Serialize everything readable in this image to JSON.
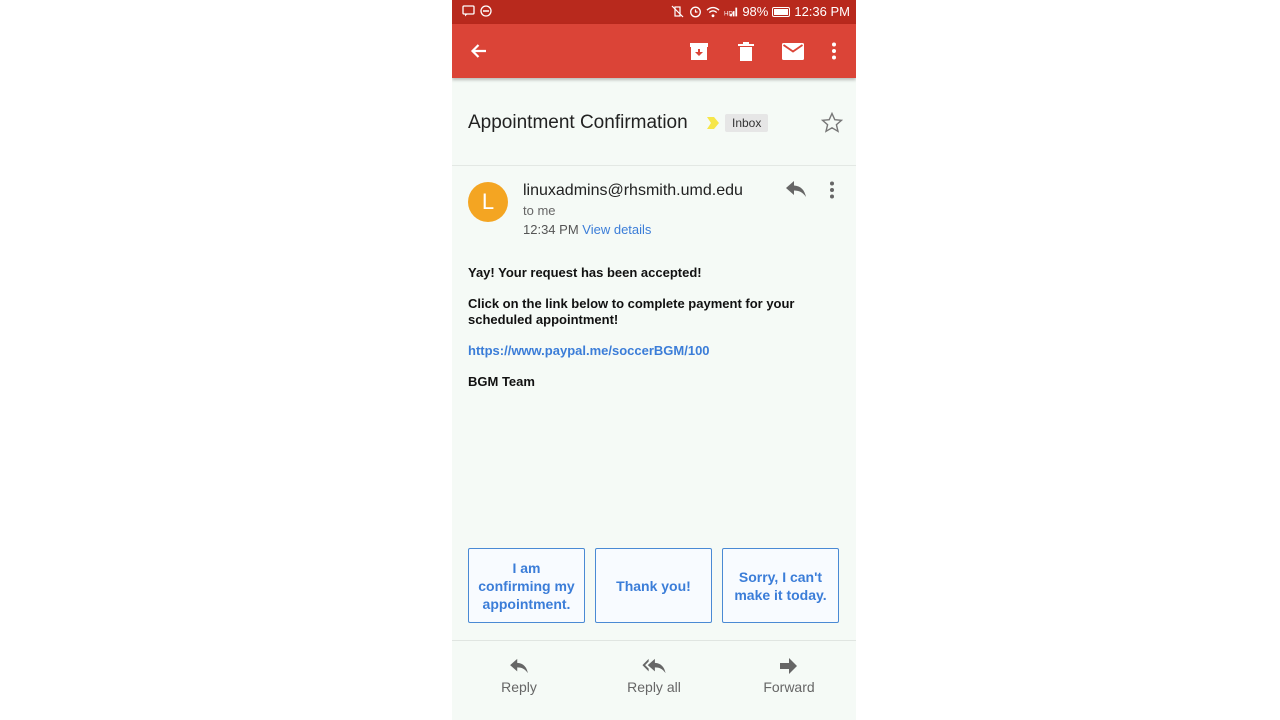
{
  "status_bar": {
    "battery": "98%",
    "time": "12:36 PM"
  },
  "email": {
    "subject": "Appointment Confirmation",
    "label": "Inbox",
    "sender_initial": "L",
    "sender": "linuxadmins@rhsmith.umd.edu",
    "recipient": "to me",
    "time": "12:34 PM",
    "view_details": "View details",
    "body": {
      "line1": "Yay! Your request has been accepted!",
      "line2": "Click on the link below to complete payment for your scheduled appointment!",
      "link": "https://www.paypal.me/soccerBGM/100",
      "signature": "BGM Team"
    }
  },
  "smart_replies": [
    "I am confirming my appointment.",
    "Thank you!",
    "Sorry, I can't make it today."
  ],
  "actions": {
    "reply": "Reply",
    "reply_all": "Reply all",
    "forward": "Forward"
  },
  "colors": {
    "status_bar": "#b8291d",
    "app_bar": "#db4437",
    "avatar": "#f4a522",
    "link": "#3b7dd8"
  }
}
